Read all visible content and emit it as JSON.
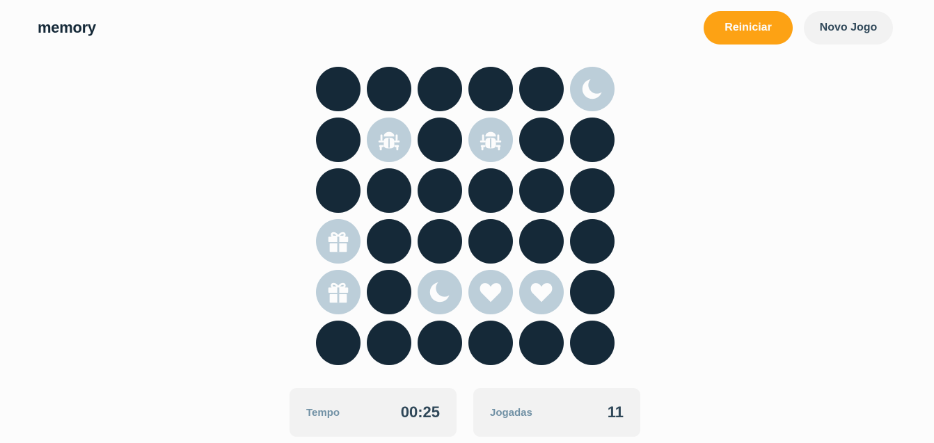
{
  "header": {
    "logo": "memory",
    "restart_label": "Reiniciar",
    "new_game_label": "Novo Jogo"
  },
  "board": {
    "columns": 6,
    "rows": 6,
    "tiles": [
      {
        "state": "hidden"
      },
      {
        "state": "hidden"
      },
      {
        "state": "hidden"
      },
      {
        "state": "hidden"
      },
      {
        "state": "hidden"
      },
      {
        "state": "matched",
        "icon": "moon"
      },
      {
        "state": "hidden"
      },
      {
        "state": "matched",
        "icon": "bug"
      },
      {
        "state": "hidden"
      },
      {
        "state": "matched",
        "icon": "bug"
      },
      {
        "state": "hidden"
      },
      {
        "state": "hidden"
      },
      {
        "state": "hidden"
      },
      {
        "state": "hidden"
      },
      {
        "state": "hidden"
      },
      {
        "state": "hidden"
      },
      {
        "state": "hidden"
      },
      {
        "state": "hidden"
      },
      {
        "state": "matched",
        "icon": "gift"
      },
      {
        "state": "hidden"
      },
      {
        "state": "hidden"
      },
      {
        "state": "hidden"
      },
      {
        "state": "hidden"
      },
      {
        "state": "hidden"
      },
      {
        "state": "matched",
        "icon": "gift"
      },
      {
        "state": "hidden"
      },
      {
        "state": "matched",
        "icon": "moon"
      },
      {
        "state": "matched",
        "icon": "heart"
      },
      {
        "state": "matched",
        "icon": "heart"
      },
      {
        "state": "hidden"
      },
      {
        "state": "hidden"
      },
      {
        "state": "hidden"
      },
      {
        "state": "hidden"
      },
      {
        "state": "hidden"
      },
      {
        "state": "hidden"
      },
      {
        "state": "hidden"
      }
    ]
  },
  "stats": {
    "time_label": "Tempo",
    "time_value": "00:25",
    "moves_label": "Jogadas",
    "moves_value": "11"
  },
  "colors": {
    "hidden_tile": "#152938",
    "matched_tile": "#bcced9",
    "accent": "#fda214"
  }
}
